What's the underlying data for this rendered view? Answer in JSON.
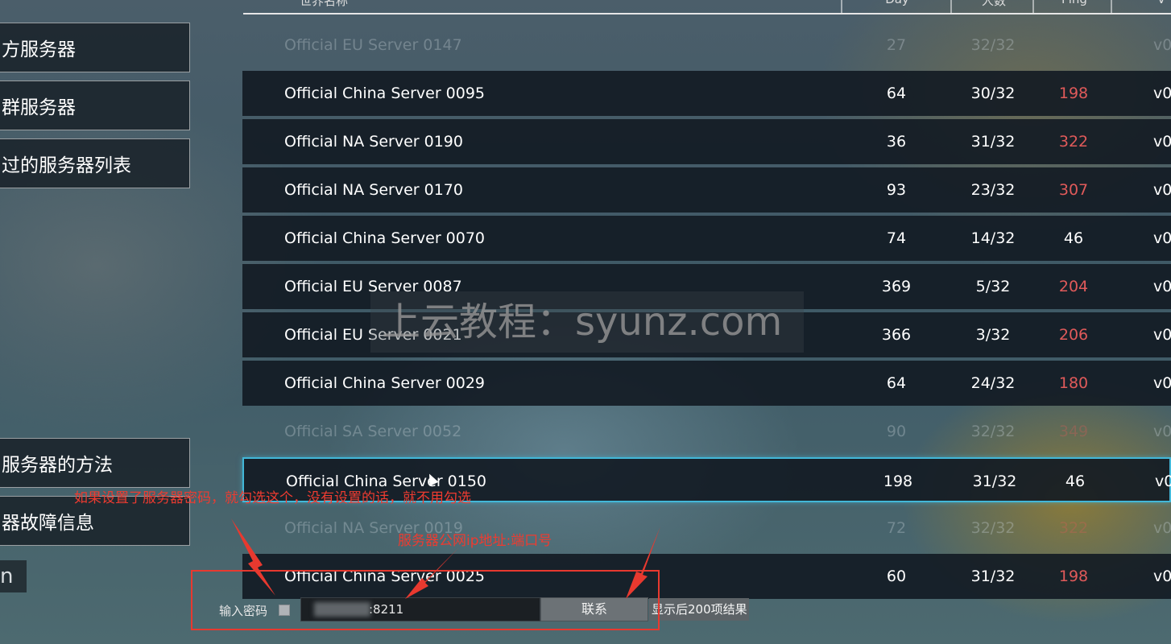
{
  "left_menu": {
    "items": [
      {
        "label": "方服务器"
      },
      {
        "label": "群服务器"
      },
      {
        "label": "过的服务器列表"
      },
      {
        "label": "服务器的方法"
      },
      {
        "label": "器故障信息"
      }
    ],
    "small_label": "n"
  },
  "table": {
    "columns": [
      "世界名称",
      "Day",
      "人数",
      "Ping",
      "V"
    ],
    "rows": [
      {
        "name": "Official EU Server 0147",
        "day": "27",
        "players": "32/32",
        "ping": "",
        "version": "v0",
        "faded": true,
        "ping_high": false
      },
      {
        "name": "Official China Server 0095",
        "day": "64",
        "players": "30/32",
        "ping": "198",
        "version": "v0",
        "faded": false,
        "ping_high": true
      },
      {
        "name": "Official NA Server 0190",
        "day": "36",
        "players": "31/32",
        "ping": "322",
        "version": "v0",
        "faded": false,
        "ping_high": true
      },
      {
        "name": "Official NA Server 0170",
        "day": "93",
        "players": "23/32",
        "ping": "307",
        "version": "v0",
        "faded": false,
        "ping_high": true
      },
      {
        "name": "Official China Server 0070",
        "day": "74",
        "players": "14/32",
        "ping": "46",
        "version": "v0",
        "faded": false,
        "ping_high": false
      },
      {
        "name": "Official EU Server 0087",
        "day": "369",
        "players": "5/32",
        "ping": "204",
        "version": "v0",
        "faded": false,
        "ping_high": true
      },
      {
        "name": "Official EU Server 0021",
        "day": "366",
        "players": "3/32",
        "ping": "206",
        "version": "v0",
        "faded": false,
        "ping_high": true
      },
      {
        "name": "Official China Server 0029",
        "day": "64",
        "players": "24/32",
        "ping": "180",
        "version": "v0",
        "faded": false,
        "ping_high": true
      },
      {
        "name": "Official SA Server 0052",
        "day": "90",
        "players": "32/32",
        "ping": "349",
        "version": "v0",
        "faded": true,
        "ping_high": true
      },
      {
        "name": "Official China Server 0150",
        "day": "198",
        "players": "31/32",
        "ping": "46",
        "version": "v0",
        "faded": false,
        "ping_high": false,
        "selected": true
      },
      {
        "name": "Official NA Server 0019",
        "day": "72",
        "players": "32/32",
        "ping": "322",
        "version": "v0",
        "faded": true,
        "ping_high": true
      },
      {
        "name": "Official China Server 0025",
        "day": "60",
        "players": "31/32",
        "ping": "198",
        "version": "v0",
        "faded": false,
        "ping_high": true
      }
    ]
  },
  "watermark": "上云教程：syunz.com",
  "bottom": {
    "password_label": "输入密码",
    "ip_value": ":8211",
    "connect_label": "联系",
    "show_after_label": "显示后200项结果"
  },
  "annotations": {
    "password_note": "如果设置了服务器密码，就勾选这个，没有设置的话，就不用勾选",
    "ip_note": "服务器公网ip地址:端口号",
    "color": "#e8392f"
  }
}
